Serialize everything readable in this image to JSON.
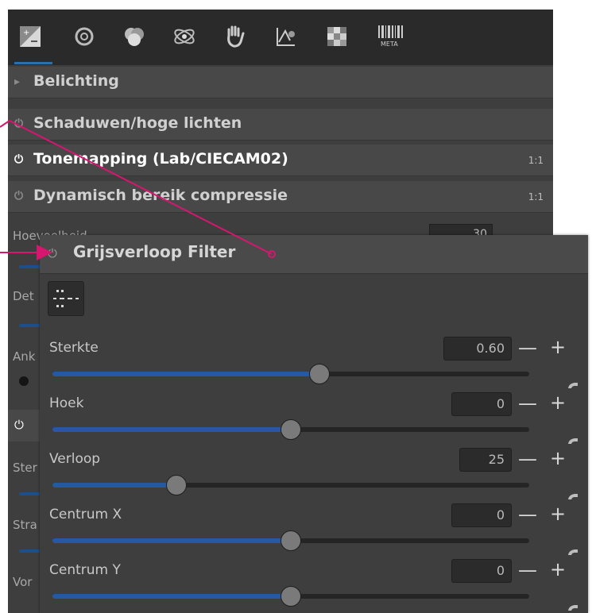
{
  "toolbar": {
    "icons": [
      "exposure-tab-icon",
      "details-tab-icon",
      "color-tab-icon",
      "advanced-tab-icon",
      "transform-tab-icon",
      "raw-tab-icon",
      "metadata-tab-icon"
    ],
    "meta_label": "META"
  },
  "sections": [
    {
      "label": "Belichting",
      "icon": "triangle-right-icon",
      "badge": ""
    },
    {
      "label": "Schaduwen/hoge lichten",
      "icon": "power-icon",
      "badge": ""
    },
    {
      "label": "Tonemapping (Lab/CIECAM02)",
      "icon": "power-icon",
      "badge": "1:1"
    },
    {
      "label": "Dynamisch bereik compressie",
      "icon": "power-icon",
      "badge": "1:1"
    }
  ],
  "background_labels": [
    "Hoeveelheid",
    "Det",
    "Ank",
    "Ster",
    "Stra",
    "Vor"
  ],
  "background_value": "30",
  "panel": {
    "title": "Grijsverloop Filter",
    "sliders": [
      {
        "label": "Sterkte",
        "value": "0.60",
        "fraction": 0.56
      },
      {
        "label": "Hoek",
        "value": "0",
        "fraction": 0.5
      },
      {
        "label": "Verloop",
        "value": "25",
        "fraction": 0.26
      },
      {
        "label": "Centrum X",
        "value": "0",
        "fraction": 0.5
      },
      {
        "label": "Centrum Y",
        "value": "0",
        "fraction": 0.5
      }
    ]
  },
  "colors": {
    "annotation": "#d6166f",
    "accent": "#2758a3"
  }
}
